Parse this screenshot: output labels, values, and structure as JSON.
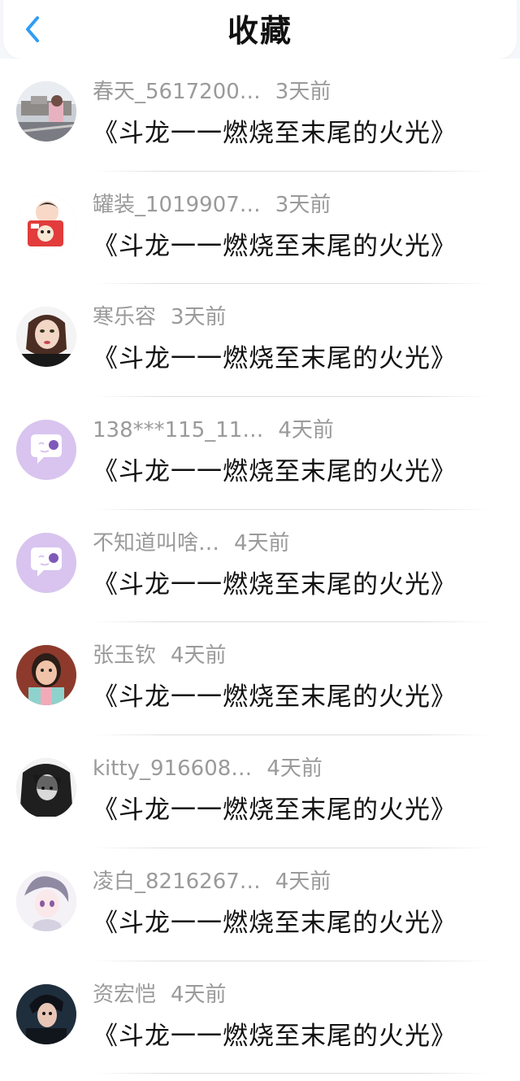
{
  "header": {
    "title": "收藏",
    "back_icon": "chevron-left-icon",
    "accent_color": "#2f9df4"
  },
  "items": [
    {
      "author": "春天_5617200…",
      "time": "3天前",
      "title": "《斗龙一一燃烧至末尾的火光》",
      "avatar": "photo-avatar"
    },
    {
      "author": "罐装_1019907…",
      "time": "3天前",
      "title": "《斗龙一一燃烧至末尾的火光》",
      "avatar": "cartoon-avatar"
    },
    {
      "author": "寒乐容",
      "time": "3天前",
      "title": "《斗龙一一燃烧至末尾的火光》",
      "avatar": "portrait-avatar"
    },
    {
      "author": "138***115_11…",
      "time": "4天前",
      "title": "《斗龙一一燃烧至末尾的火光》",
      "avatar": "default-chat-avatar"
    },
    {
      "author": "不知道叫啥…",
      "time": "4天前",
      "title": "《斗龙一一燃烧至末尾的火光》",
      "avatar": "default-chat-avatar"
    },
    {
      "author": "张玉钦",
      "time": "4天前",
      "title": "《斗龙一一燃烧至末尾的火光》",
      "avatar": "girl-photo-avatar"
    },
    {
      "author": "kitty_916608…",
      "time": "4天前",
      "title": "《斗龙一一燃烧至末尾的火光》",
      "avatar": "sketch-avatar"
    },
    {
      "author": "凌白_8216267…",
      "time": "4天前",
      "title": "《斗龙一一燃烧至末尾的火光》",
      "avatar": "anime-avatar"
    },
    {
      "author": "资宏恺",
      "time": "4天前",
      "title": "《斗龙一一燃烧至末尾的火光》",
      "avatar": "dark-portrait-avatar"
    }
  ]
}
